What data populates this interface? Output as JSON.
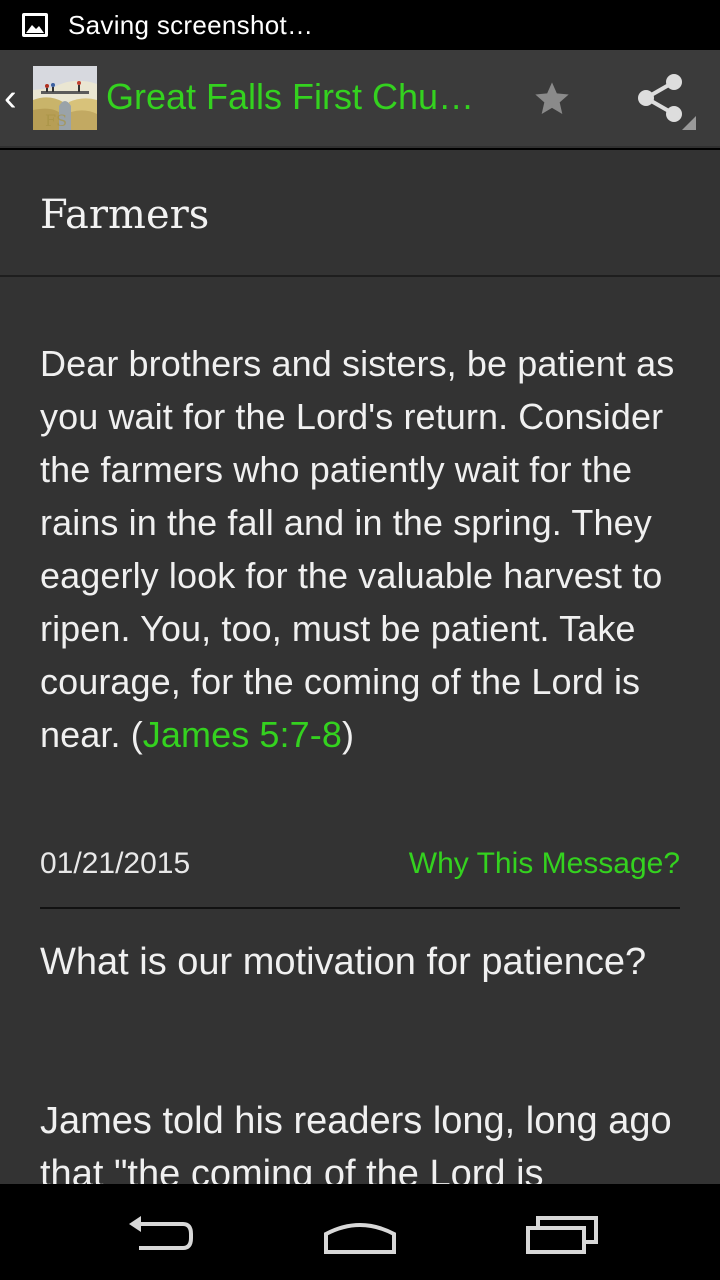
{
  "status_bar": {
    "text": "Saving screenshot…",
    "icon": "image-icon"
  },
  "action_bar": {
    "title": "Great Falls First Chur…",
    "back_icon": "chevron-left-icon",
    "favorite_icon": "star-icon",
    "share_icon": "share-icon",
    "accent_color": "#34d21f"
  },
  "post": {
    "title": "Farmers",
    "scripture_text": "Dear brothers and sisters, be patient as you wait for the Lord's return. Consider the farmers who patiently wait for the rains in the fall and in the spring. They eagerly look for the valuable harvest to ripen. You, too, must be patient. Take courage, for the coming of the Lord is near.",
    "scripture_open": "(",
    "scripture_reference": "James 5:7-8",
    "scripture_close": ")",
    "date": "01/21/2015",
    "why_link": "Why This Message?",
    "paragraphs": [
      "What is our motivation for patience?",
      "James told his readers long, long ago that \"the coming of the Lord is"
    ]
  },
  "nav_bar": {
    "back": "back-icon",
    "home": "home-icon",
    "recents": "recents-icon"
  }
}
